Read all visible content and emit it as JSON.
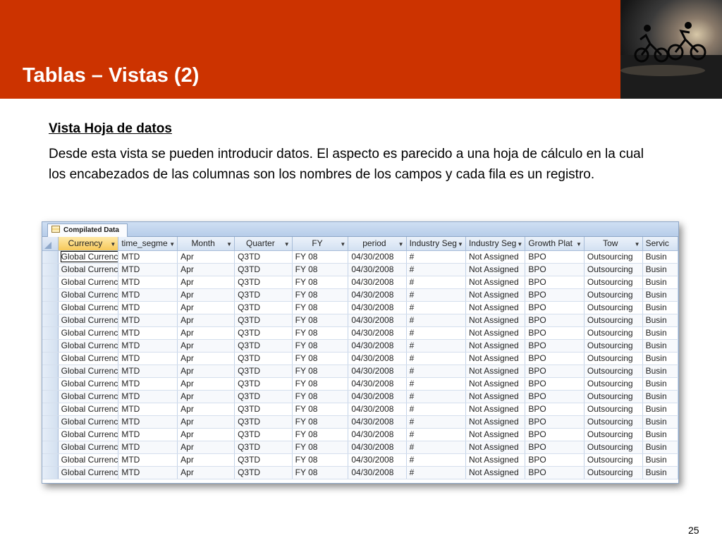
{
  "slide": {
    "title": "Tablas – Vistas (2)",
    "subheading": "Vista Hoja de datos",
    "body": "Desde esta vista se pueden introducir datos. El aspecto es parecido a una hoja de cálculo en la cual los encabezados de las columnas son los nombres de los campos y cada fila es un registro.",
    "page_number": "25"
  },
  "datasheet": {
    "tab_label": "Compilated Data",
    "columns": [
      "Currency",
      "time_segme",
      "Month",
      "Quarter",
      "FY",
      "period",
      "Industry Seg",
      "Industry Seg",
      "Growth Plat",
      "Tow",
      "Servic"
    ],
    "rows": [
      [
        "Global Currenc",
        "MTD",
        "Apr",
        "Q3TD",
        "FY 08",
        "04/30/2008",
        "#",
        "Not Assigned",
        "BPO",
        "Outsourcing",
        "Busin"
      ],
      [
        "Global Currenc",
        "MTD",
        "Apr",
        "Q3TD",
        "FY 08",
        "04/30/2008",
        "#",
        "Not Assigned",
        "BPO",
        "Outsourcing",
        "Busin"
      ],
      [
        "Global Currenc",
        "MTD",
        "Apr",
        "Q3TD",
        "FY 08",
        "04/30/2008",
        "#",
        "Not Assigned",
        "BPO",
        "Outsourcing",
        "Busin"
      ],
      [
        "Global Currenc",
        "MTD",
        "Apr",
        "Q3TD",
        "FY 08",
        "04/30/2008",
        "#",
        "Not Assigned",
        "BPO",
        "Outsourcing",
        "Busin"
      ],
      [
        "Global Currenc",
        "MTD",
        "Apr",
        "Q3TD",
        "FY 08",
        "04/30/2008",
        "#",
        "Not Assigned",
        "BPO",
        "Outsourcing",
        "Busin"
      ],
      [
        "Global Currenc",
        "MTD",
        "Apr",
        "Q3TD",
        "FY 08",
        "04/30/2008",
        "#",
        "Not Assigned",
        "BPO",
        "Outsourcing",
        "Busin"
      ],
      [
        "Global Currenc",
        "MTD",
        "Apr",
        "Q3TD",
        "FY 08",
        "04/30/2008",
        "#",
        "Not Assigned",
        "BPO",
        "Outsourcing",
        "Busin"
      ],
      [
        "Global Currenc",
        "MTD",
        "Apr",
        "Q3TD",
        "FY 08",
        "04/30/2008",
        "#",
        "Not Assigned",
        "BPO",
        "Outsourcing",
        "Busin"
      ],
      [
        "Global Currenc",
        "MTD",
        "Apr",
        "Q3TD",
        "FY 08",
        "04/30/2008",
        "#",
        "Not Assigned",
        "BPO",
        "Outsourcing",
        "Busin"
      ],
      [
        "Global Currenc",
        "MTD",
        "Apr",
        "Q3TD",
        "FY 08",
        "04/30/2008",
        "#",
        "Not Assigned",
        "BPO",
        "Outsourcing",
        "Busin"
      ],
      [
        "Global Currenc",
        "MTD",
        "Apr",
        "Q3TD",
        "FY 08",
        "04/30/2008",
        "#",
        "Not Assigned",
        "BPO",
        "Outsourcing",
        "Busin"
      ],
      [
        "Global Currenc",
        "MTD",
        "Apr",
        "Q3TD",
        "FY 08",
        "04/30/2008",
        "#",
        "Not Assigned",
        "BPO",
        "Outsourcing",
        "Busin"
      ],
      [
        "Global Currenc",
        "MTD",
        "Apr",
        "Q3TD",
        "FY 08",
        "04/30/2008",
        "#",
        "Not Assigned",
        "BPO",
        "Outsourcing",
        "Busin"
      ],
      [
        "Global Currenc",
        "MTD",
        "Apr",
        "Q3TD",
        "FY 08",
        "04/30/2008",
        "#",
        "Not Assigned",
        "BPO",
        "Outsourcing",
        "Busin"
      ],
      [
        "Global Currenc",
        "MTD",
        "Apr",
        "Q3TD",
        "FY 08",
        "04/30/2008",
        "#",
        "Not Assigned",
        "BPO",
        "Outsourcing",
        "Busin"
      ],
      [
        "Global Currenc",
        "MTD",
        "Apr",
        "Q3TD",
        "FY 08",
        "04/30/2008",
        "#",
        "Not Assigned",
        "BPO",
        "Outsourcing",
        "Busin"
      ],
      [
        "Global Currenc",
        "MTD",
        "Apr",
        "Q3TD",
        "FY 08",
        "04/30/2008",
        "#",
        "Not Assigned",
        "BPO",
        "Outsourcing",
        "Busin"
      ],
      [
        "Global Currenc",
        "MTD",
        "Apr",
        "Q3TD",
        "FY 08",
        "04/30/2008",
        "#",
        "Not Assigned",
        "BPO",
        "Outsourcing",
        "Busin"
      ]
    ]
  },
  "colors": {
    "banner": "#cc3300",
    "header_row": "#d3e1f2",
    "active_header": "#f7c95a"
  }
}
